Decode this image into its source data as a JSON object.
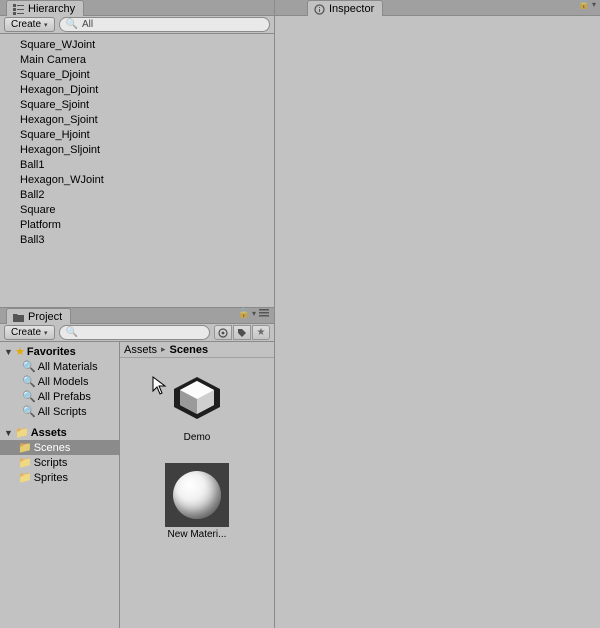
{
  "hierarchy": {
    "tab_label": "Hierarchy",
    "create_label": "Create",
    "search_text": "All",
    "items": [
      "Square_WJoint",
      "Main Camera",
      "Square_Djoint",
      "Hexagon_Djoint",
      "Square_Sjoint",
      "Hexagon_Sjoint",
      "Square_Hjoint",
      "Hexagon_Sljoint",
      "Ball1",
      "Hexagon_WJoint",
      "Ball2",
      "Square",
      "Platform",
      "Ball3"
    ]
  },
  "project": {
    "tab_label": "Project",
    "create_label": "Create",
    "favorites_label": "Favorites",
    "favorites": [
      "All Materials",
      "All Models",
      "All Prefabs",
      "All Scripts"
    ],
    "assets_label": "Assets",
    "asset_folders": [
      "Scenes",
      "Scripts",
      "Sprites"
    ],
    "selected_folder_index": 0,
    "breadcrumb": [
      "Assets",
      "Scenes"
    ],
    "grid_items": [
      {
        "name": "Demo",
        "type": "scene"
      },
      {
        "name": "New Materi...",
        "type": "material"
      }
    ]
  },
  "inspector": {
    "tab_label": "Inspector"
  }
}
